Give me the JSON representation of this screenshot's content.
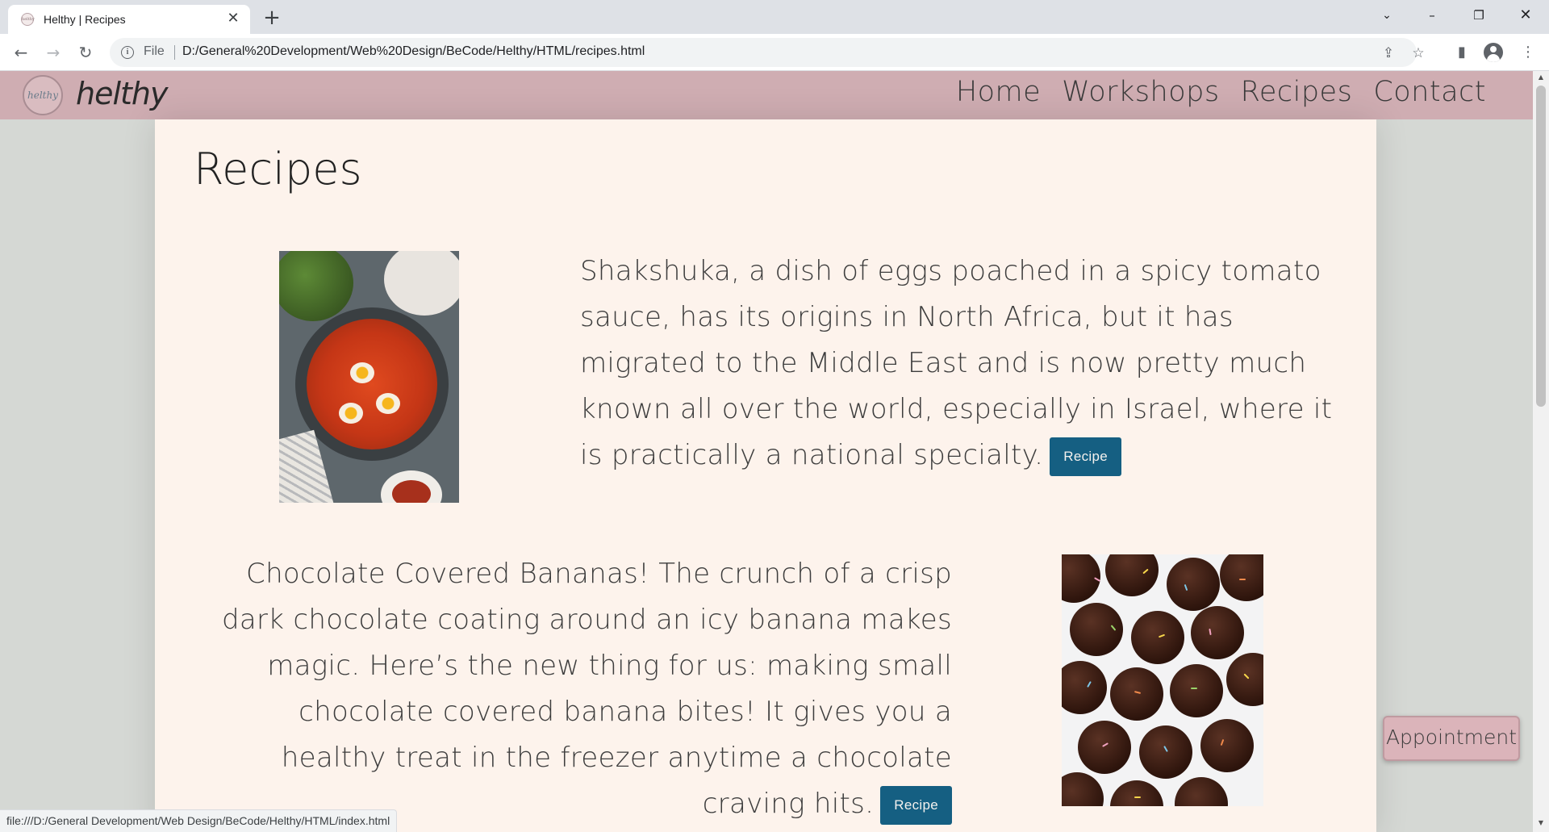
{
  "browser": {
    "tab_title": "Helthy | Recipes",
    "favicon_text": "helthy",
    "url_scheme": "File",
    "url": "D:/General%20Development/Web%20Design/BeCode/Helthy/HTML/recipes.html",
    "status_url": "file:///D:/General Development/Web Design/BeCode/Helthy/HTML/index.html"
  },
  "site": {
    "logo_mark": "helthy",
    "logo_text": "helthy",
    "nav": [
      {
        "label": "Home"
      },
      {
        "label": "Workshops"
      },
      {
        "label": "Recipes"
      },
      {
        "label": "Contact"
      }
    ]
  },
  "page": {
    "title": "Recipes",
    "recipes": [
      {
        "text": "Shakshuka, a dish of eggs poached in a spicy tomato sauce, has its origins in North Africa, but it has migrated to the Middle East and is now pretty much known all over the world, especially in Israel, where it is practically a national specialty.",
        "button": "Recipe",
        "image": "shakshuka-photo"
      },
      {
        "text": "Chocolate Covered Bananas! The crunch of a crisp dark chocolate coating around an icy banana makes magic. Here’s the new thing for us: making small chocolate covered banana bites! It gives you a healthy treat in the freezer anytime a chocolate craving hits.",
        "button": "Recipe",
        "image": "chocolate-banana-bites-photo"
      }
    ],
    "appointment": "Appointment"
  },
  "colors": {
    "header": "#cfadb2",
    "content_bg": "#fdf3ec",
    "button": "#155f82",
    "page_bg": "#d5d8d4"
  }
}
